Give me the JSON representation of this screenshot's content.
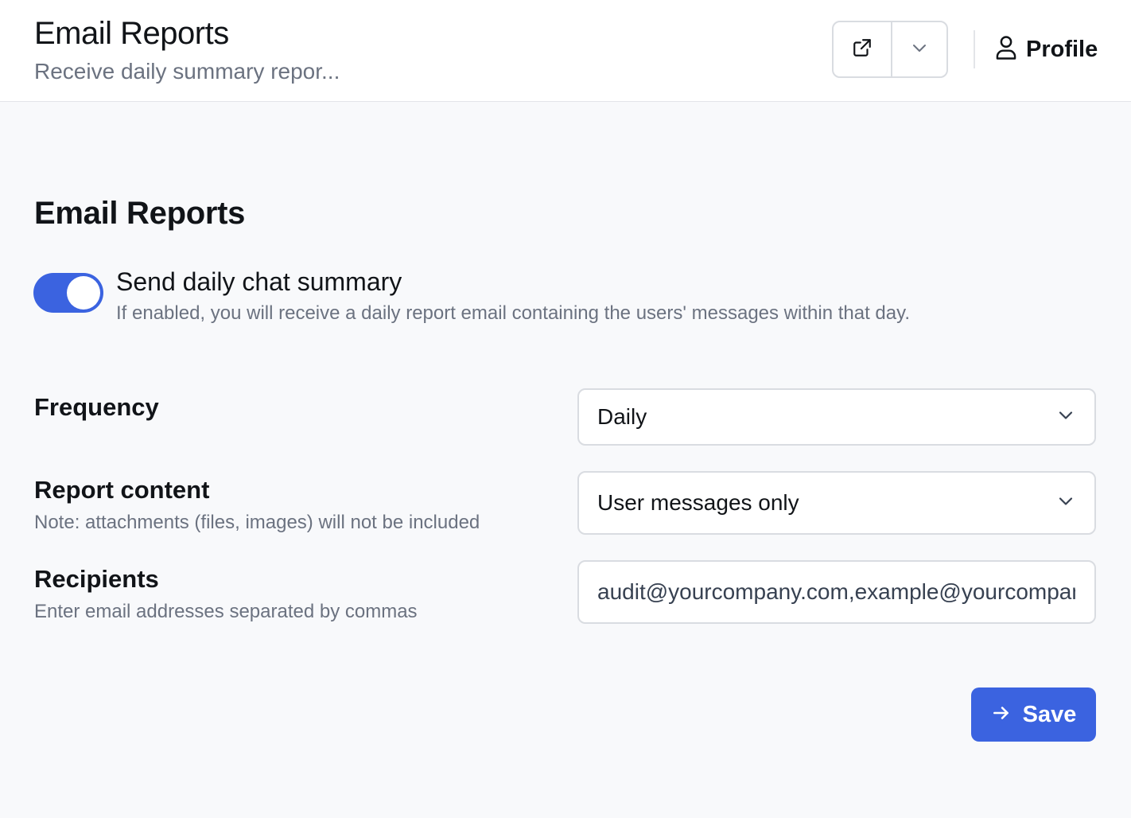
{
  "header": {
    "title": "Email Reports",
    "subtitle": "Receive daily summary repor...",
    "open_external_icon": "external-link-icon",
    "dropdown_icon": "chevron-down-icon",
    "profile_icon": "user-icon",
    "profile_label": "Profile"
  },
  "section": {
    "title": "Email Reports"
  },
  "daily_summary": {
    "enabled": true,
    "title": "Send daily chat summary",
    "description": "If enabled, you will receive a daily report email containing the users' messages within that day."
  },
  "frequency": {
    "label": "Frequency",
    "value": "Daily"
  },
  "report_content": {
    "label": "Report content",
    "note": "Note: attachments (files, images) will not be included",
    "value": "User messages only"
  },
  "recipients": {
    "label": "Recipients",
    "note": "Enter email addresses separated by commas",
    "value": "audit@yourcompany.com,example@yourcompany.com"
  },
  "save": {
    "label": "Save",
    "icon": "arrow-right-icon"
  },
  "colors": {
    "accent": "#3b63e0",
    "background": "#f8f9fb",
    "muted_text": "#6b7280",
    "border": "#d9dce1"
  }
}
